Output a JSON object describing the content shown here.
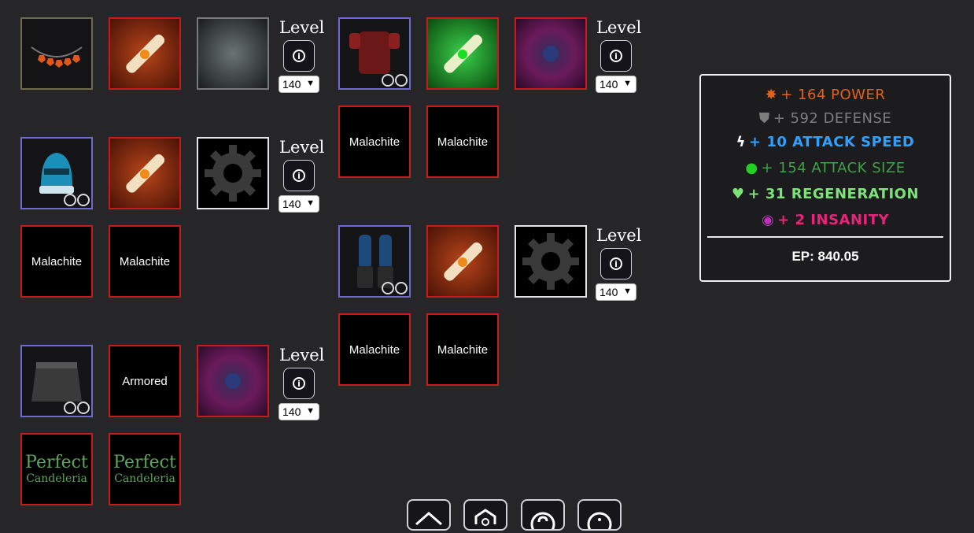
{
  "gem_label": "Malachite",
  "armored_label": "Armored",
  "perfect": {
    "line1": "Perfect",
    "line2": "Candeleria"
  },
  "level": {
    "title": "Level",
    "value": "140",
    "info_glyph": "i"
  },
  "stats": {
    "power": "+ 164 POWER",
    "defense": "+ 592 DEFENSE",
    "attack_speed": "+ 10 ATTACK SPEED",
    "attack_size": "+ 154 ATTACK SIZE",
    "regeneration": "+ 31 REGENERATION",
    "insanity": "+ 2 INSANITY",
    "ep": "EP: 840.05"
  },
  "colors": {
    "power": "#e0611a",
    "defense": "#7d7d7d",
    "attack_speed": "#2fa0ff",
    "attack_size": "#3fa046",
    "regeneration": "#7ee07a",
    "insanity": "#e8237a"
  },
  "nav_icons": [
    "home-icon",
    "shield-home-icon",
    "help-icon",
    "info-icon"
  ]
}
